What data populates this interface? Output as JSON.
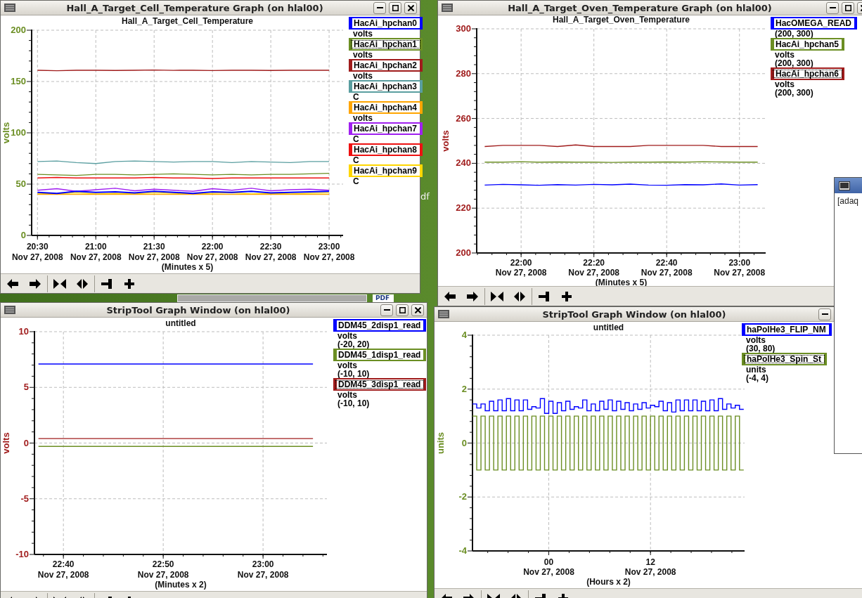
{
  "desktop": {
    "label": "df",
    "file_icon_label": "PDF"
  },
  "windows": [
    {
      "title": "Hall_A_Target_Cell_Temperature Graph (on hlal00)",
      "chart_data": {
        "type": "line",
        "title": "Hall_A_Target_Cell_Temperature",
        "xlabel": "(Minutes x 5)",
        "ylabel": "volts",
        "grid": true,
        "categories": [
          "20:30",
          null,
          null,
          "21:00",
          null,
          null,
          "21:30",
          null,
          null,
          "22:00",
          null,
          null,
          "22:30",
          null,
          null,
          "23:00"
        ],
        "ylim": [
          0,
          200
        ],
        "yticks": [
          0,
          50,
          100,
          150,
          200
        ],
        "series": [
          {
            "name": "HacAi_hpchan0",
            "color": "#0000ff",
            "values": [
              42,
              41,
              43,
              42,
              42.5,
              41.5,
              43,
              42,
              41,
              42.5,
              42,
              43,
              41.5,
              42,
              42.5,
              43
            ]
          },
          {
            "name": "HacAi_hpchan1",
            "color": "#6b8e23",
            "values": [
              59.5,
              59,
              58.5,
              59.5,
              59.5,
              59,
              59.5,
              60,
              59.5,
              59,
              59.5,
              59,
              59.5,
              59.5,
              60,
              60.5
            ]
          },
          {
            "name": "HacAi_hpchan2",
            "color": "#a01c1c",
            "values": [
              161,
              160.5,
              161,
              161,
              160.8,
              161,
              161.2,
              160.9,
              161,
              160.7,
              161,
              161,
              160.8,
              161,
              161,
              161
            ]
          },
          {
            "name": "HacAi_hpchan3",
            "color": "#5a9ea0",
            "values": [
              72,
              72.5,
              71,
              70,
              72,
              72.5,
              72,
              71.5,
              72,
              72,
              71,
              72,
              71.5,
              71,
              72,
              72
            ]
          },
          {
            "name": "HacAi_hpchan4",
            "color": "#ffa500",
            "values": [
              40,
              40,
              40,
              40,
              40,
              40,
              40,
              40,
              40,
              40,
              40,
              40,
              40,
              40,
              40,
              40
            ]
          },
          {
            "name": "HacAi_hpchan7",
            "color": "#a020f0",
            "values": [
              44,
              45.5,
              43,
              44.5,
              46,
              43.5,
              45,
              44,
              43,
              45.5,
              44,
              46,
              43.5,
              44.5,
              45,
              44
            ]
          },
          {
            "name": "HacAi_hpchan8",
            "color": "#ee1111",
            "values": [
              56,
              56.5,
              56,
              56,
              56,
              56,
              56.5,
              56,
              56,
              55.5,
              56,
              56,
              56,
              56,
              56,
              56
            ]
          },
          {
            "name": "HacAi_hpchan9",
            "color": "#ffd700",
            "values": [
              41,
              40.5,
              41.5,
              40.5,
              41,
              40.5,
              41.5,
              41,
              40.5,
              41,
              41.5,
              40.5,
              41,
              40.5,
              41,
              41.5
            ]
          }
        ]
      },
      "tick_dates": [
        "Nov 27, 2008",
        "Nov 27, 2008",
        "Nov 27, 2008",
        "Nov 27, 2008",
        "Nov 27, 2008",
        "Nov 27, 2008"
      ],
      "legend": [
        {
          "units": "volts",
          "selected": false
        },
        {
          "units": "volts",
          "selected": true
        },
        {
          "units": "volts",
          "selected": false
        },
        {
          "units": "C",
          "selected": false
        },
        {
          "units": "volts",
          "selected": false
        },
        {
          "units": "C",
          "selected": false
        },
        {
          "units": "C",
          "selected": false
        },
        {
          "units": "C",
          "selected": false
        }
      ]
    },
    {
      "title": "Hall_A_Target_Oven_Temperature Graph (on hlal00)",
      "chart_data": {
        "type": "line",
        "title": "Hall_A_Target_Oven_Temperature",
        "xlabel": "(Minutes x 5)",
        "ylabel": "volts",
        "grid": true,
        "categories": [
          null,
          null,
          "22:00",
          null,
          null,
          null,
          "22:20",
          null,
          null,
          null,
          "22:40",
          null,
          null,
          null,
          "23:00",
          null
        ],
        "ylim": [
          200,
          300
        ],
        "yticks": [
          200,
          220,
          240,
          260,
          280,
          300
        ],
        "series": [
          {
            "name": "HacOMEGA_READ",
            "color": "#0000ff",
            "values": [
              230.3,
              230.6,
              230.4,
              230.2,
              230.5,
              230.3,
              230.6,
              230.4,
              230.7,
              230.3,
              230.2,
              230.5,
              230.4,
              230.8,
              230.3,
              230.5
            ]
          },
          {
            "name": "HacAi_hpchan5",
            "color": "#6b8e23",
            "values": [
              240.5,
              240.5,
              240.7,
              240.5,
              240.6,
              240.5,
              240.5,
              240.4,
              240.5,
              240.5,
              240.6,
              240.5,
              240.7,
              240.6,
              240.5,
              240.5
            ]
          },
          {
            "name": "HacAi_hpchan6",
            "color": "#a01c1c",
            "values": [
              247.5,
              248,
              248,
              248,
              247.5,
              248.2,
              247.5,
              247.5,
              247.5,
              248,
              248,
              248,
              248,
              247.5,
              247.5,
              247.5
            ]
          }
        ]
      },
      "tick_dates": [
        "Nov 27, 2008",
        "Nov 27, 2008",
        "Nov 27, 2008",
        "Nov 27, 2008"
      ],
      "legend": [
        {
          "range": "(200, 300)",
          "selected": false
        },
        {
          "units": "volts",
          "range": "(200, 300)",
          "selected": false
        },
        {
          "units": "volts",
          "range": "(200, 300)",
          "selected": true
        }
      ]
    },
    {
      "title": "StripTool Graph Window (on hlal00)",
      "chart_data": {
        "type": "line",
        "title": "untitled",
        "xlabel": "(Minutes x 2)",
        "ylabel": "volts",
        "grid": true,
        "categories": [
          null,
          "22:40",
          null,
          null,
          null,
          "22:50",
          null,
          null,
          null,
          "23:00",
          null,
          null
        ],
        "ylim": [
          -10,
          10
        ],
        "yticks": [
          -10,
          -5,
          0,
          5,
          10
        ],
        "series": [
          {
            "name": "DDM45_2disp1_read",
            "color": "#0000ff",
            "values": [
              7.1,
              7.1,
              7.1,
              7.1,
              7.1,
              7.1,
              7.1,
              7.1,
              7.1,
              7.1,
              7.1,
              7.1
            ]
          },
          {
            "name": "DDM45_1disp1_read",
            "color": "#6b8e23",
            "values": [
              -0.3,
              -0.3,
              -0.3,
              -0.3,
              -0.3,
              -0.3,
              -0.3,
              -0.3,
              -0.3,
              -0.3,
              -0.3,
              -0.3
            ]
          },
          {
            "name": "DDM45_3disp1_read",
            "color": "#a01c1c",
            "values": [
              0.4,
              0.4,
              0.4,
              0.4,
              0.4,
              0.4,
              0.4,
              0.4,
              0.4,
              0.4,
              0.4,
              0.4
            ]
          }
        ]
      },
      "tick_dates": [
        "Nov 27, 2008",
        "Nov 27, 2008",
        "Nov 27, 2008"
      ],
      "legend": [
        {
          "units": "volts",
          "range": "(-20, 20)",
          "selected": false
        },
        {
          "units": "volts",
          "range": "(-10, 10)",
          "selected": false
        },
        {
          "units": "volts",
          "range": "(-10, 10)",
          "selected": true
        }
      ]
    },
    {
      "title": "StripTool Graph Window (on hlal00)",
      "chart_data": {
        "type": "line",
        "title": "untitled",
        "xlabel": "(Hours x 2)",
        "ylabel": "units",
        "grid": true,
        "x": [
          -9,
          -8.5,
          -8.5,
          -8,
          -8,
          -7.5,
          -7.5,
          -7,
          -7,
          -6.5,
          -6.5,
          -6,
          -6,
          -5.5,
          -5.5,
          -5,
          -5,
          -4.5,
          -4.5,
          -4,
          -4,
          -3.5,
          -3.5,
          -3,
          -3,
          -2.5,
          -2.5,
          -2,
          -2,
          -1.5,
          -1.5,
          -1,
          -1,
          -0.5,
          -0.5,
          0,
          0,
          0.5,
          0.5,
          1,
          1,
          1.5,
          1.5,
          2,
          2,
          2.5,
          2.5,
          3,
          3,
          3.5,
          3.5,
          4,
          4,
          4.5,
          4.5,
          5,
          5,
          5.5,
          5.5,
          6,
          6,
          6.5,
          6.5,
          7,
          7,
          7.5,
          7.5,
          8,
          8,
          8.5,
          8.5,
          9,
          9,
          9.5,
          9.5,
          10,
          10,
          10.5,
          10.5,
          11,
          11,
          11.5,
          11.5,
          12,
          12,
          12.5,
          12.5,
          13,
          13,
          13.5,
          13.5,
          14,
          14,
          14.5,
          14.5,
          15,
          15,
          15.5,
          15.5,
          16,
          16,
          16.5,
          16.5,
          17,
          17,
          17.5,
          17.5,
          18,
          18,
          18.5,
          18.5,
          19,
          19,
          19.5,
          19.5,
          20,
          20,
          20.5,
          20.5,
          21,
          21,
          21.5,
          21.5,
          22,
          22,
          22.5,
          22.5,
          23
        ],
        "xlim": [
          -9,
          23.1
        ],
        "ylim": [
          -4,
          4
        ],
        "yticks": [
          -4,
          -2,
          0,
          2,
          4
        ],
        "xticks": [
          {
            "value": 0,
            "label": "00"
          },
          {
            "value": 12,
            "label": "12"
          }
        ],
        "series": [
          {
            "name": "haPolHe3_FLIP_NM",
            "color": "#0000ff",
            "values": [
              1.45,
              1.45,
              1.3,
              1.3,
              1.45,
              1.45,
              1.2,
              1.2,
              1.55,
              1.55,
              1.2,
              1.2,
              1.6,
              1.6,
              1.2,
              1.2,
              1.65,
              1.65,
              1.2,
              1.2,
              1.6,
              1.6,
              1.2,
              1.2,
              1.6,
              1.6,
              1.25,
              1.25,
              1.35,
              1.35,
              1.3,
              1.3,
              1.65,
              1.65,
              1.1,
              1.1,
              1.55,
              1.55,
              1.1,
              1.1,
              1.5,
              1.5,
              1.2,
              1.2,
              1.55,
              1.55,
              1.25,
              1.25,
              1.35,
              1.35,
              1.3,
              1.3,
              1.6,
              1.6,
              1.2,
              1.2,
              1.45,
              1.45,
              1.2,
              1.2,
              1.55,
              1.55,
              1.25,
              1.25,
              1.6,
              1.6,
              1.2,
              1.2,
              1.55,
              1.55,
              1.25,
              1.25,
              1.5,
              1.5,
              1.2,
              1.2,
              1.45,
              1.45,
              1.25,
              1.25,
              1.5,
              1.5,
              1.3,
              1.3,
              1.4,
              1.4,
              1.35,
              1.35,
              1.55,
              1.55,
              1.2,
              1.2,
              1.5,
              1.5,
              1.15,
              1.15,
              1.6,
              1.6,
              1.2,
              1.2,
              1.6,
              1.6,
              1.2,
              1.2,
              1.6,
              1.6,
              1.2,
              1.2,
              1.55,
              1.55,
              1.2,
              1.2,
              1.6,
              1.6,
              1.2,
              1.2,
              1.65,
              1.65,
              1.25,
              1.25,
              1.45,
              1.45,
              1.3,
              1.3,
              1.4,
              1.4,
              1.25,
              1.25
            ]
          },
          {
            "name": "haPolHe3_Spin_St",
            "color": "#6b8e23",
            "values": [
              1,
              1,
              -1,
              -1,
              1,
              1,
              -1,
              -1,
              1,
              1,
              -1,
              -1,
              1,
              1,
              -1,
              -1,
              1,
              1,
              -1,
              -1,
              1,
              1,
              -1,
              -1,
              1,
              1,
              -1,
              -1,
              1,
              1,
              -1,
              -1,
              1,
              1,
              -1,
              -1,
              1,
              1,
              -1,
              -1,
              1,
              1,
              -1,
              -1,
              1,
              1,
              -1,
              -1,
              1,
              1,
              -1,
              -1,
              1,
              1,
              -1,
              -1,
              1,
              1,
              -1,
              -1,
              1,
              1,
              -1,
              -1,
              1,
              1,
              -1,
              -1,
              1,
              1,
              -1,
              -1,
              1,
              1,
              -1,
              -1,
              1,
              1,
              -1,
              -1,
              1,
              1,
              -1,
              -1,
              1,
              1,
              -1,
              -1,
              1,
              1,
              -1,
              -1,
              1,
              1,
              -1,
              -1,
              1,
              1,
              -1,
              -1,
              1,
              1,
              -1,
              -1,
              1,
              1,
              -1,
              -1,
              1,
              1,
              -1,
              -1,
              1,
              1,
              -1,
              -1,
              1,
              1,
              -1,
              -1,
              1,
              1,
              -1,
              -1,
              1,
              1,
              -1,
              -1
            ]
          }
        ]
      },
      "tick_dates": [
        "Nov 27, 2008",
        "Nov 27, 2008"
      ],
      "legend": [
        {
          "units": "volts",
          "range": "(30, 80)",
          "selected": false
        },
        {
          "units": "units",
          "range": "(-4, 4)",
          "selected": true
        }
      ]
    }
  ],
  "terminal": {
    "text": "[adaq"
  }
}
